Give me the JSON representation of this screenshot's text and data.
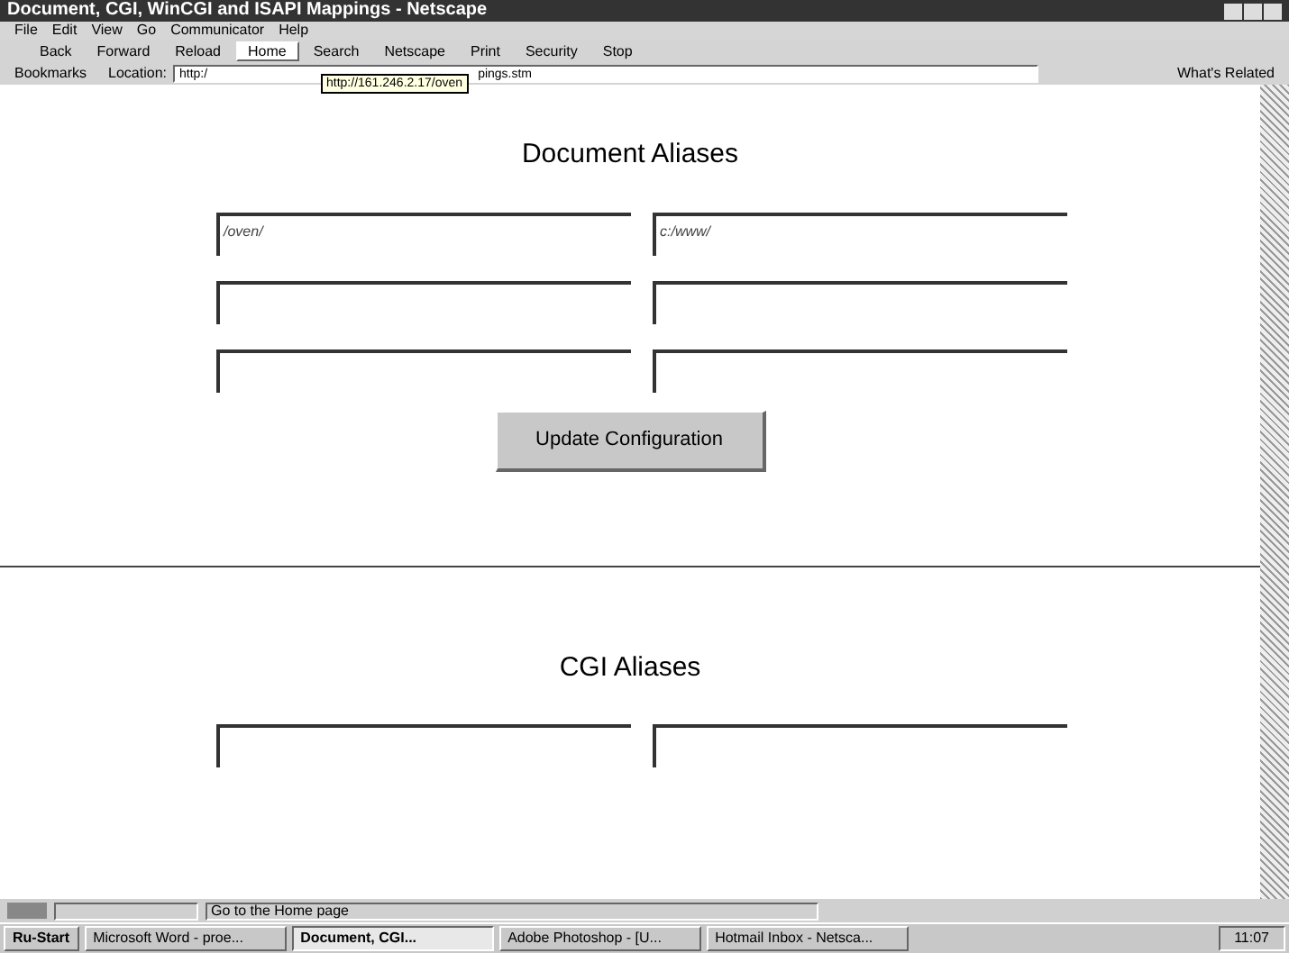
{
  "window": {
    "title": "Document, CGI, WinCGI and ISAPI Mappings - Netscape"
  },
  "menu": [
    "File",
    "Edit",
    "View",
    "Go",
    "Communicator",
    "Help"
  ],
  "toolbar": [
    {
      "label": "Back",
      "selected": false
    },
    {
      "label": "Forward",
      "selected": false
    },
    {
      "label": "Reload",
      "selected": false
    },
    {
      "label": "Home",
      "selected": true
    },
    {
      "label": "Search",
      "selected": false
    },
    {
      "label": "Netscape",
      "selected": false
    },
    {
      "label": "Print",
      "selected": false
    },
    {
      "label": "Security",
      "selected": false
    },
    {
      "label": "Stop",
      "selected": false
    }
  ],
  "location_bar": {
    "bookmarks": "Bookmarks",
    "label": "Location:",
    "value_start": "http:/",
    "value_end": "pings.stm",
    "tooltip": "http://161.246.2.17/oven",
    "related": "What's Related"
  },
  "sections": [
    {
      "title": "Document Aliases",
      "rows": [
        [
          "/oven/",
          "c:/www/"
        ],
        [
          "",
          ""
        ],
        [
          "",
          ""
        ]
      ],
      "button": "Update Configuration"
    },
    {
      "title": "CGI Aliases",
      "rows": [
        [
          "",
          ""
        ]
      ]
    }
  ],
  "status_bar": {
    "text": "Go to the Home page"
  },
  "taskbar": {
    "start": "Ru-Start",
    "tasks": [
      {
        "label": "Microsoft Word - proe...",
        "selected": false
      },
      {
        "label": "Document, CGI...",
        "selected": true
      },
      {
        "label": "Adobe Photoshop - [U...",
        "selected": false
      },
      {
        "label": "Hotmail Inbox - Netsca...",
        "selected": false
      }
    ],
    "clock": "11:07"
  }
}
